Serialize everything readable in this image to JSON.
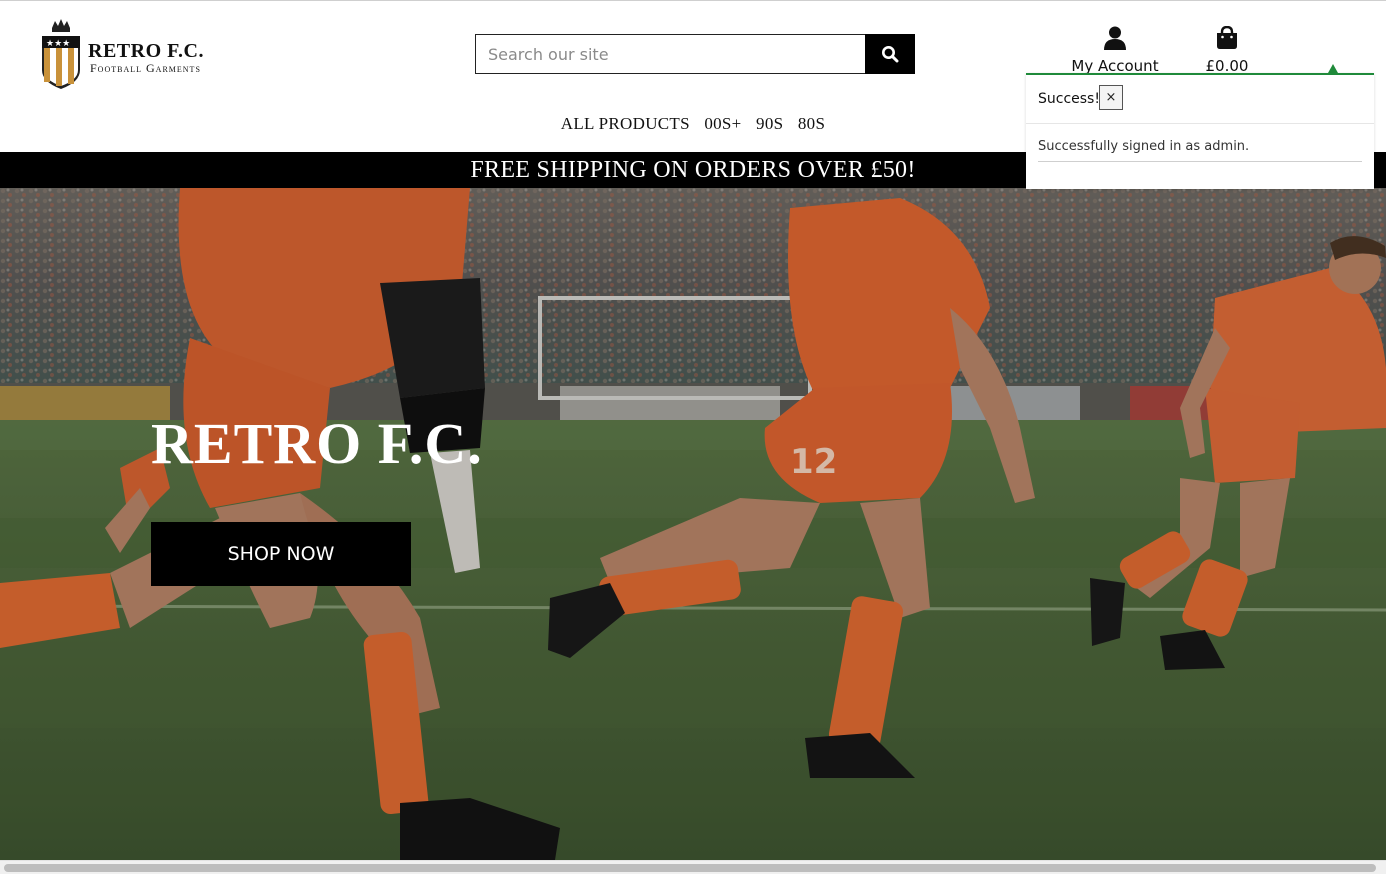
{
  "brand": {
    "name": "RETRO F.C.",
    "subtitle": "Football Garments",
    "logo_icon": "crest-shield-icon"
  },
  "search": {
    "placeholder": "Search our site",
    "button_icon": "search-icon"
  },
  "account": {
    "label": "My Account",
    "icon": "user-icon"
  },
  "bag": {
    "total": "£0.00",
    "icon": "shopping-bag-icon"
  },
  "nav": {
    "items": [
      "ALL PRODUCTS",
      "00S+",
      "90S",
      "80S"
    ]
  },
  "banner": {
    "text": "FREE SHIPPING ON ORDERS OVER £50!"
  },
  "hero": {
    "title": "RETRO F.C.",
    "cta_label": "SHOP NOW"
  },
  "toast": {
    "title": "Success!",
    "close_label": "×",
    "message": "Successfully signed in as admin.",
    "accent_color": "#1f8a3a"
  },
  "colors": {
    "kit_orange": "#e8642a",
    "banner_bg": "#000000",
    "pitch_green": "#4e6b39"
  }
}
